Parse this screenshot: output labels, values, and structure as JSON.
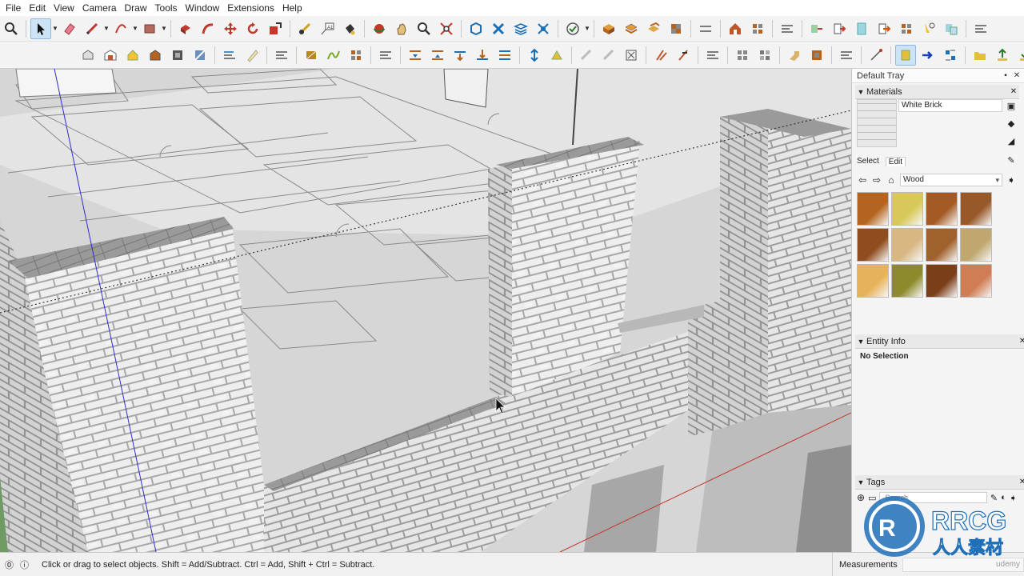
{
  "menu": [
    "File",
    "Edit",
    "View",
    "Camera",
    "Draw",
    "Tools",
    "Window",
    "Extensions",
    "Help"
  ],
  "tray": {
    "title": "Default Tray",
    "materials": {
      "title": "Materials",
      "current": "White Brick",
      "tabs": [
        "Select",
        "Edit"
      ],
      "library": "Wood",
      "swatch_colors": [
        "#b5641f",
        "#d8c85a",
        "#a35a24",
        "#98592a",
        "#8f4c1e",
        "#d8b783",
        "#a0622c",
        "#bfa76f",
        "#e7b35a",
        "#8c8a2a",
        "#7a3e18",
        "#d07d55"
      ]
    },
    "entity_info": {
      "title": "Entity Info",
      "status": "No Selection"
    },
    "tags": {
      "title": "Tags",
      "search_placeholder": "Search"
    }
  },
  "status": {
    "hint": "Click or drag to select objects. Shift = Add/Subtract. Ctrl = Add, Shift + Ctrl = Subtract.",
    "measurements_label": "Measurements",
    "measurements_value": "udemy"
  },
  "watermark": {
    "logo_text": "RRCG",
    "sub_text": "人人素材"
  },
  "icons": {
    "toolbar1": [
      "search-icon",
      "select-arrow-icon",
      "eraser-icon",
      "pencil-line-icon",
      "arc-icon",
      "rectangle-icon",
      "push-pull-icon",
      "follow-me-icon",
      "move-icon",
      "rotate-icon",
      "scale-icon",
      "tape-measure-icon",
      "text-label-icon",
      "paint-bucket-icon",
      "orbit-icon",
      "pan-icon",
      "zoom-icon",
      "zoom-extents-icon",
      "3d-warehouse-icon",
      "extension-warehouse-icon",
      "layout-icon",
      "extension-manager-icon",
      "section-plane-icon",
      "sandbox-icon",
      "style-icon",
      "shadow-icon",
      "house-icon",
      "camera-icon",
      "solid-tools-icon",
      "sandbox-smoove-icon",
      "dimension-icon",
      "protractor-icon",
      "advanced-camera-icon",
      "walk-icon"
    ],
    "toolbar2": [
      "iso-view-icon",
      "top-view-icon",
      "front-view-icon",
      "right-view-icon",
      "back-view-icon",
      "left-view-icon",
      "xray-icon",
      "wireframe-icon",
      "hidden-line-icon",
      "shaded-icon",
      "textured-icon",
      "monochrome-icon",
      "section-cut-icon",
      "section-fill-icon",
      "display-section-icon",
      "axes-icon",
      "guides-icon",
      "fog-icon",
      "edge-style-icon",
      "position-camera-icon",
      "look-around-icon",
      "intersect-icon",
      "union-icon",
      "subtract-icon",
      "trim-icon",
      "split-icon",
      "outer-shell-icon",
      "soften-icon",
      "component-icon",
      "import-icon",
      "export-icon",
      "dynamic-component-icon",
      "generate-report-icon"
    ]
  },
  "colors": {
    "accent": "#cde4f7",
    "brick": "#e6e6e6",
    "mortar": "#a9a9a9",
    "axis_blue": "#2c2cd0",
    "axis_red": "#c0392b"
  }
}
